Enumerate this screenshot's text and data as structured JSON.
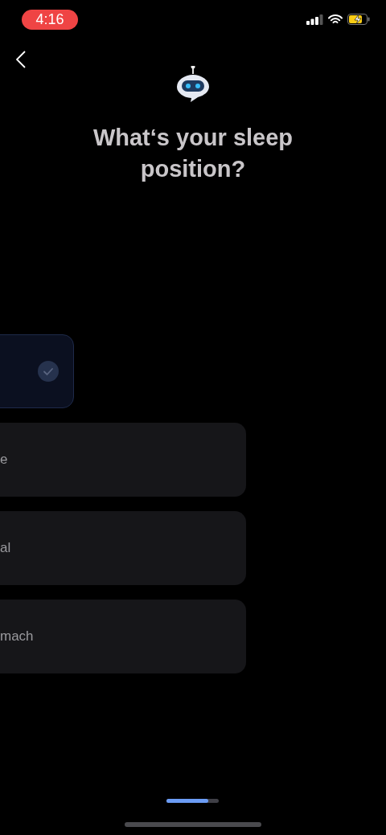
{
  "status_bar": {
    "time": "4:16"
  },
  "title": "What‘s your sleep position?",
  "options": [
    {
      "selected": true
    },
    {
      "label": "e",
      "selected": false
    },
    {
      "label": "al",
      "selected": false
    },
    {
      "label": "mach",
      "selected": false
    }
  ],
  "progress": {
    "level": 0.8
  }
}
